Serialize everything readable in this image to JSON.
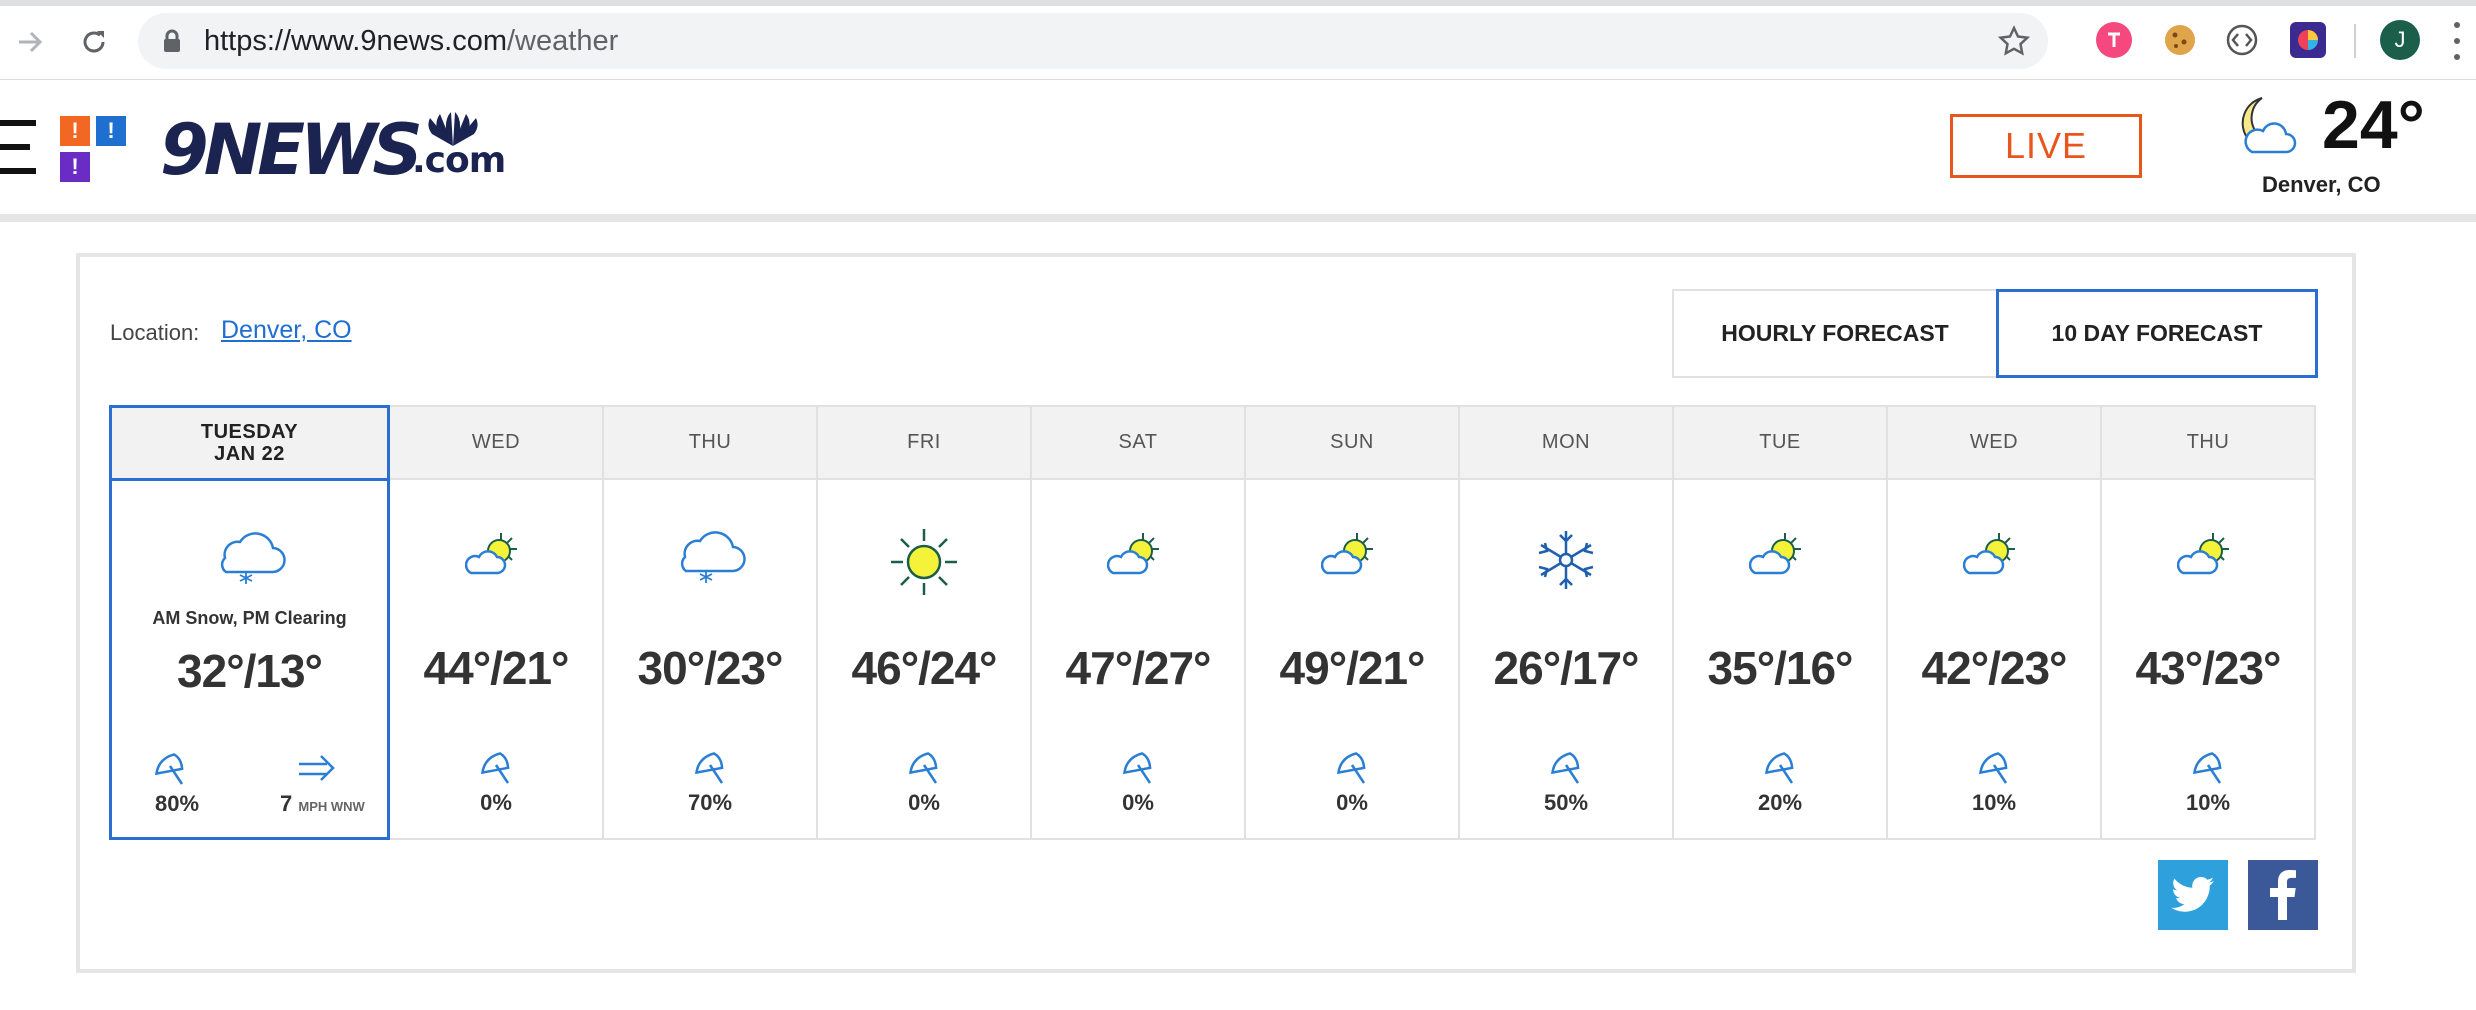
{
  "browser": {
    "url_domain": "https://www.9news.com",
    "url_path": "/weather",
    "avatar_letter": "J"
  },
  "header": {
    "logo_text": "9NEWS",
    "logo_suffix": ".com",
    "alert_mark": "!",
    "live_label": "LIVE",
    "current_temp": "24°",
    "current_city": "Denver, CO"
  },
  "forecast": {
    "location_label": "Location:",
    "location_value": "Denver, CO",
    "tabs": [
      {
        "label": "HOURLY FORECAST",
        "active": false
      },
      {
        "label": "10 DAY FORECAST",
        "active": true
      }
    ],
    "today": {
      "day": "TUESDAY",
      "date": "JAN 22",
      "icon": "cloud-snow-icon",
      "condition": "AM Snow, PM Clearing",
      "temps": "32°/13°",
      "precip": "80%",
      "wind_speed": "7",
      "wind_unit": "MPH WNW"
    },
    "days": [
      {
        "day": "WED",
        "icon": "partly-sunny-icon",
        "temps": "44°/21°",
        "precip": "0%"
      },
      {
        "day": "THU",
        "icon": "cloud-snow-icon",
        "temps": "30°/23°",
        "precip": "70%"
      },
      {
        "day": "FRI",
        "icon": "sun-icon",
        "temps": "46°/24°",
        "precip": "0%"
      },
      {
        "day": "SAT",
        "icon": "partly-sunny-icon",
        "temps": "47°/27°",
        "precip": "0%"
      },
      {
        "day": "SUN",
        "icon": "partly-sunny-icon",
        "temps": "49°/21°",
        "precip": "0%"
      },
      {
        "day": "MON",
        "icon": "snowflake-icon",
        "temps": "26°/17°",
        "precip": "50%"
      },
      {
        "day": "TUE",
        "icon": "partly-sunny-icon",
        "temps": "35°/16°",
        "precip": "20%"
      },
      {
        "day": "WED",
        "icon": "partly-sunny-icon",
        "temps": "42°/23°",
        "precip": "10%"
      },
      {
        "day": "THU",
        "icon": "partly-sunny-icon",
        "temps": "43°/23°",
        "precip": "10%"
      }
    ]
  },
  "colors": {
    "accent_blue": "#2a6fd0",
    "link_blue": "#1f6fd1",
    "live_orange": "#e8561e",
    "logo_navy": "#1b2350",
    "sun_yellow": "#f5f23a",
    "icon_blue": "#2a7fd4"
  }
}
